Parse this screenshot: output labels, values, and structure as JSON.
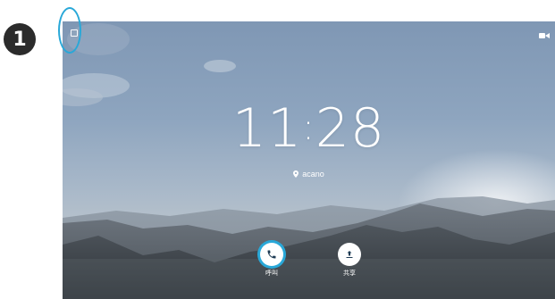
{
  "step_marker": "1",
  "clock": {
    "hours": "11",
    "minutes": "28"
  },
  "location": {
    "name": "acano",
    "icon": "location-pin-icon"
  },
  "actions": {
    "call": {
      "label": "呼叫",
      "icon": "phone-icon"
    },
    "share": {
      "label": "共享",
      "icon": "upload-share-icon"
    }
  },
  "status_icons": {
    "top_left": "square-icon",
    "top_right": "camera-icon"
  },
  "colors": {
    "highlight": "#29a8d8",
    "sky": "#8ea5bf"
  }
}
